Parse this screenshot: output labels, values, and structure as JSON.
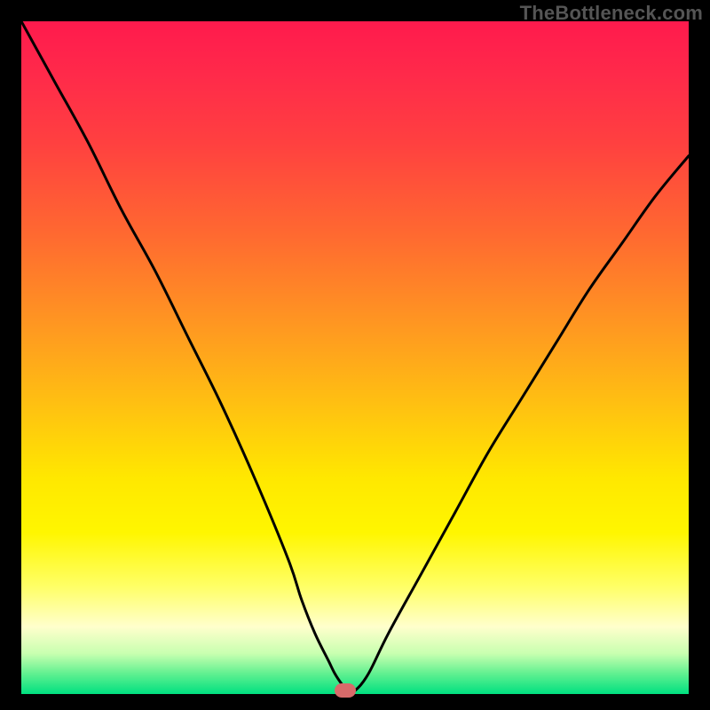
{
  "watermark": "TheBottleneck.com",
  "chart_data": {
    "type": "line",
    "title": "",
    "xlabel": "",
    "ylabel": "",
    "xlim": [
      0,
      100
    ],
    "ylim": [
      0,
      100
    ],
    "x": [
      0,
      5,
      10,
      15,
      20,
      25,
      30,
      35,
      40,
      42,
      44,
      46,
      47,
      48,
      49,
      50,
      52,
      55,
      60,
      65,
      70,
      75,
      80,
      85,
      90,
      95,
      100
    ],
    "series": [
      {
        "name": "bottleneck-curve",
        "values": [
          100,
          91,
          82,
          72,
          63,
          53,
          43,
          32,
          20,
          14,
          9,
          5,
          3,
          1.5,
          0.3,
          0.5,
          3,
          9,
          18,
          27,
          36,
          44,
          52,
          60,
          67,
          74,
          80
        ]
      }
    ],
    "annotations": [
      {
        "name": "optimal-marker",
        "x": 48.5,
        "y": 0.5,
        "color": "#d86a6a"
      }
    ],
    "background_gradient": {
      "top": "#ff1a4d",
      "mid": "#fff600",
      "bottom": "#00e080"
    }
  }
}
